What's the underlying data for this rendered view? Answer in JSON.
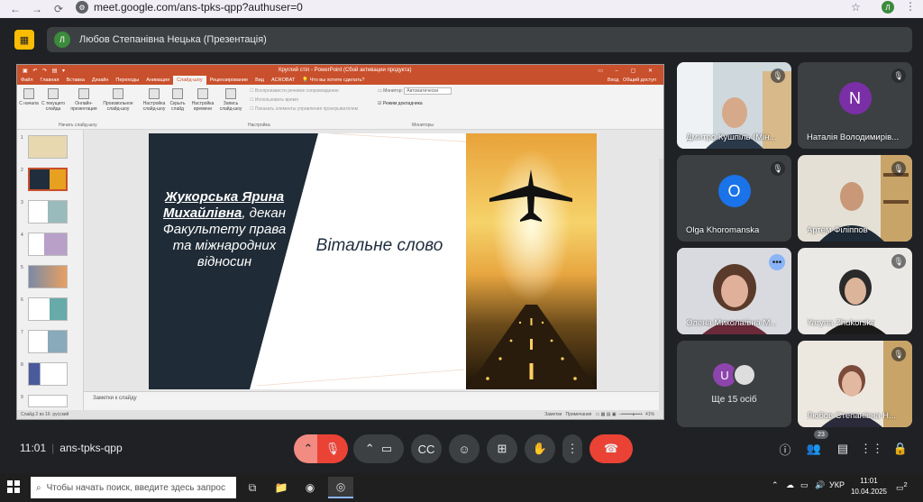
{
  "browser": {
    "url": "meet.google.com/ans-tpks-qpp?authuser=0",
    "profile_letter": "Л"
  },
  "header": {
    "presenter_avatar": "Л",
    "presenter_label": "Любов Степанівна Нецька (Презентація)"
  },
  "powerpoint": {
    "window_title": "Круглий стіл - PowerPoint (Сбой активации продукта)",
    "tabs": [
      "Файл",
      "Главная",
      "Вставка",
      "Дизайн",
      "Переходы",
      "Анимация",
      "Слайд-шоу",
      "Рецензирование",
      "Вид",
      "ACROBAT"
    ],
    "active_tab": "Слайд-шоу",
    "tell_me": "Что вы хотите сделать?",
    "account": "Вход",
    "share": "Общий доступ",
    "ribbon_buttons": [
      {
        "label": "С начала"
      },
      {
        "label": "С текущего слайда"
      },
      {
        "label": "Онлайн-презентация"
      },
      {
        "label": "Произвольное слайд-шоу"
      },
      {
        "label": "Настройка слайд-шоу"
      },
      {
        "label": "Скрыть слайд"
      },
      {
        "label": "Настройка времени"
      },
      {
        "label": "Запись слайд-шоу"
      }
    ],
    "ribbon_checks": [
      "Воспроизвести речевое сопровождение",
      "Использовать время",
      "Показать элементы управления проигрывателем"
    ],
    "monitor_label": "Монитор:",
    "monitor_value": "Автоматически",
    "presenter_mode": "Режим докладчика",
    "groups": [
      "Начать слайд-шоу",
      "Настройка",
      "Мониторы"
    ],
    "slide": {
      "name_line1": "Жукорська Ярина Михайлівна",
      "name_line2": ", декан Факультету права та міжнародних відносин",
      "greeting": "Вітальне слово"
    },
    "notes_placeholder": "Заметки к слайду",
    "status_left": "Слайд 2 из 16",
    "status_lang": "русский",
    "status_notes": "Заметки",
    "status_comments": "Примечания",
    "zoom": "41%",
    "thumb_numbers": [
      "1",
      "2",
      "3",
      "4",
      "5",
      "6",
      "7",
      "8",
      "9"
    ]
  },
  "participants": [
    {
      "name": "Дмитро Кушпіль (Мін...",
      "type": "video",
      "muted": true
    },
    {
      "name": "Наталія Володимирів...",
      "type": "avatar",
      "letter": "N",
      "color": "#7b2fa6",
      "muted": true
    },
    {
      "name": "Olga Khoromanska",
      "type": "avatar",
      "letter": "O",
      "color": "#1a73e8",
      "muted": true
    },
    {
      "name": "Артем Філіппов",
      "type": "video",
      "muted": true
    },
    {
      "name": "Олена Миколаївна М...",
      "type": "video",
      "speaking": true
    },
    {
      "name": "Yaryna Zhukorska",
      "type": "video",
      "muted": true
    },
    {
      "name": "Ще 15 осіб",
      "type": "more",
      "letter": "U"
    },
    {
      "name": "Любов Степанівна Н...",
      "type": "video",
      "muted": true
    }
  ],
  "bottom_bar": {
    "time": "11:01",
    "meeting_code": "ans-tpks-qpp",
    "people_count": "23",
    "chat_badge": "2"
  },
  "taskbar": {
    "search_placeholder": "Чтобы начать поиск, введите здесь запрос",
    "language": "УКР",
    "time": "11:01",
    "date": "10.04.2025",
    "notification_count": "2"
  }
}
